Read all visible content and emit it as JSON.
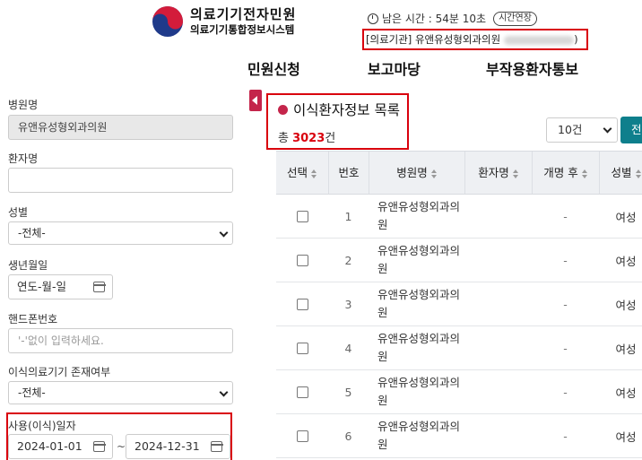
{
  "header": {
    "logo_line1": "의료기기전자민원",
    "logo_line2": "의료기기통합정보시스템",
    "timer_text": "남은 시간 : 54분 10초",
    "extend_label": "시간연장",
    "institution_text": "[의료기관] 유앤유성형외과의원"
  },
  "nav": {
    "items": [
      "민원신청",
      "보고마당",
      "부작용환자통보"
    ]
  },
  "filters": {
    "hospital_label": "병원명",
    "hospital_value": "유앤유성형외과의원",
    "patient_label": "환자명",
    "patient_value": "",
    "gender_label": "성별",
    "gender_value": "-전체-",
    "birth_label": "생년월일",
    "birth_placeholder": "연도-월-일",
    "phone_label": "핸드폰번호",
    "phone_placeholder": "'-'없이 입력하세요.",
    "device_label": "이식의료기기 존재여부",
    "device_value": "-전체-",
    "date_label": "사용(이식)일자",
    "date_from": "2024-01-01",
    "date_tilde": "~",
    "date_to": "2024-12-31"
  },
  "list": {
    "title": "이식환자정보 목록",
    "total_prefix": "총 ",
    "total_count": "3023",
    "total_suffix": "건",
    "page_size": "10건",
    "search_label": "전"
  },
  "table": {
    "headers": [
      "선택",
      "번호",
      "병원명",
      "환자명",
      "개명 후",
      "성별"
    ],
    "rows": [
      {
        "no": "1",
        "hospital": "유앤유성형외과의원",
        "renamed": "-",
        "gender": "여성"
      },
      {
        "no": "2",
        "hospital": "유앤유성형외과의원",
        "renamed": "-",
        "gender": "여성"
      },
      {
        "no": "3",
        "hospital": "유앤유성형외과의원",
        "renamed": "-",
        "gender": "여성"
      },
      {
        "no": "4",
        "hospital": "유앤유성형외과의원",
        "renamed": "-",
        "gender": "여성"
      },
      {
        "no": "5",
        "hospital": "유앤유성형외과의원",
        "renamed": "-",
        "gender": "여성"
      },
      {
        "no": "6",
        "hospital": "유앤유성형외과의원",
        "renamed": "-",
        "gender": "여성"
      }
    ]
  },
  "colors": {
    "accent_red": "#d9000d",
    "brand_crimson": "#c4254b",
    "button_teal": "#0e7f8c"
  }
}
